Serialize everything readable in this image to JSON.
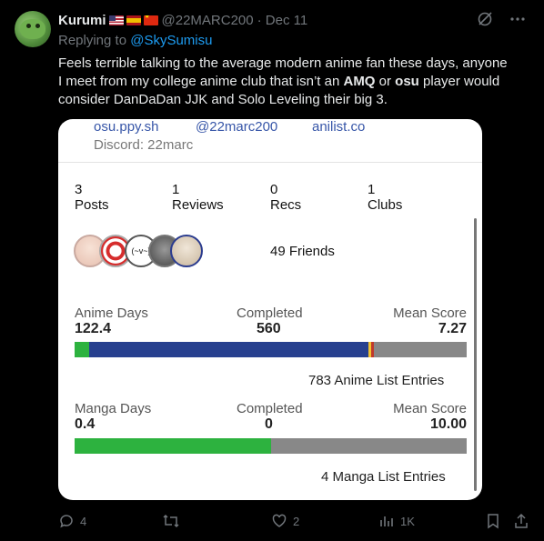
{
  "tweet": {
    "author_name": "Kurumi",
    "handle": "@22MARC200",
    "time": "· Dec 11",
    "replying_prefix": "Replying to ",
    "replying_to": "@SkySumisu",
    "text_before_amq": "Feels terrible talking to the average modern anime fan these days, anyone I meet from my college anime club that isn’t an ",
    "amq": "AMQ",
    "text_or": " or ",
    "osu": "osu",
    "text_after": " player would consider DanDaDan JJK and Solo Leveling their big 3."
  },
  "profile_card": {
    "links": [
      "osu.ppy.sh",
      "@22marc200",
      "anilist.co"
    ],
    "discord": "Discord: 22marc",
    "stats": [
      {
        "value": "3",
        "label": "Posts"
      },
      {
        "value": "1",
        "label": "Reviews"
      },
      {
        "value": "0",
        "label": "Recs"
      },
      {
        "value": "1",
        "label": "Clubs"
      }
    ],
    "friends": "49 Friends",
    "anime": {
      "days_label": "Anime Days",
      "days_value": "122.4",
      "completed_label": "Completed",
      "completed_value": "560",
      "mean_label": "Mean Score",
      "mean_value": "7.27",
      "entries": "783 Anime List Entries",
      "bar_fractions": [
        0.037,
        0.712,
        0.007,
        0.008,
        0.236
      ]
    },
    "manga": {
      "days_label": "Manga Days",
      "days_value": "0.4",
      "completed_label": "Completed",
      "completed_value": "0",
      "mean_label": "Mean Score",
      "mean_value": "10.00",
      "entries": "4 Manga List Entries",
      "bar_fractions": [
        0.5,
        0.5
      ]
    }
  },
  "actions": {
    "replies": "4",
    "reposts": "",
    "likes": "2",
    "views": "1K"
  },
  "colors": {
    "link": "#1d9bf0",
    "muted": "#71767b",
    "bar_green": "#2db23f",
    "bar_blue": "#27408f",
    "bar_yellow": "#f2c230",
    "bar_red": "#c0392b",
    "bar_gray": "#888888"
  }
}
